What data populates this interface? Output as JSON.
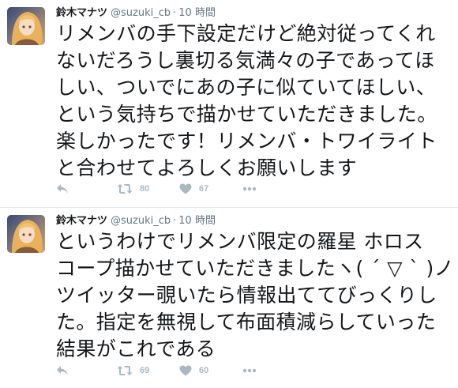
{
  "tweets": [
    {
      "name": "鈴木マナツ",
      "handle": "@suzuki_cb",
      "separator": "·",
      "time": "10 時間",
      "text": "リメンバの手下設定だけど絶対従ってくれ\nないだろうし裏切る気満々の子であってほ\nしい、ついでにあの子に似ていてほしい、\nという気持ちで描かせていただきました。\n楽しかったです！リメンバ・トワイライト\nと合わせてよろしくお願いします",
      "retweets": "80",
      "likes": "67"
    },
    {
      "name": "鈴木マナツ",
      "handle": "@suzuki_cb",
      "separator": "·",
      "time": "10 時間",
      "text": "というわけでリメンバ限定の羅星 ホロス\nコープ描かせていただきましたヽ( ´ ▽ ` )ノ\nツイッター覗いたら情報出ててびっくりし\nた。指定を無視して布面積減らしていった\n結果がこれである",
      "retweets": "69",
      "likes": "60"
    }
  ],
  "icons": {
    "reply": "reply-icon",
    "retweet": "retweet-icon",
    "like": "heart-icon",
    "more": "more-icon"
  },
  "colors": {
    "text": "#14171a",
    "secondary": "#657786",
    "action": "#aab8c2",
    "divider": "#e1e8ed"
  }
}
